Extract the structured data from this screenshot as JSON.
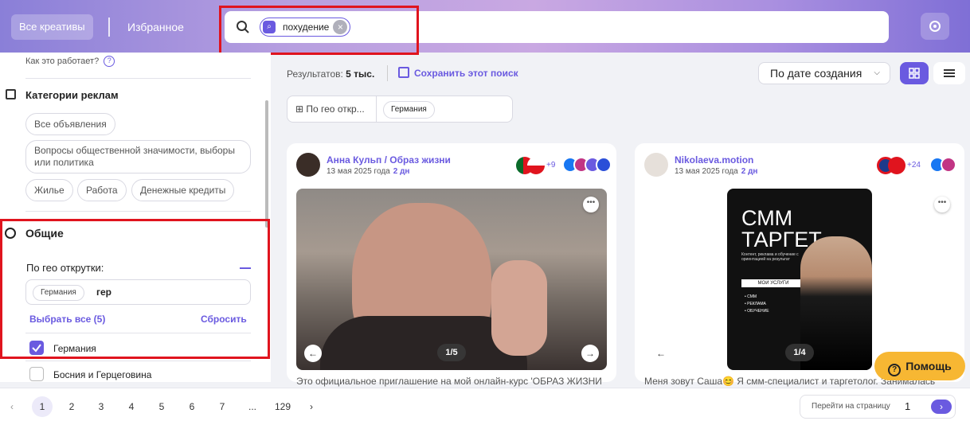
{
  "header": {
    "tab_all": "Все креативы",
    "tab_favorites": "Избранное",
    "search_chip": "похудение",
    "accent": "#6a5ae0"
  },
  "sidebar": {
    "how_it_works": "Как это работает?",
    "categories_title": "Категории реклам",
    "tags": [
      "Все объявления",
      "Вопросы общественной значимости, выборы или политика",
      "Жилье",
      "Работа",
      "Денежные кредиты"
    ],
    "general_title": "Общие",
    "geo_label": "По гео открутки:",
    "geo_chip": "Германия",
    "geo_query": "гер",
    "select_all": "Выбрать все (5)",
    "reset": "Сбросить",
    "options": [
      {
        "label": "Германия",
        "checked": true
      },
      {
        "label": "Босния и Герцеговина",
        "checked": false
      }
    ]
  },
  "toolbar": {
    "results_label": "Результатов:",
    "results_value": "5 тыс.",
    "save_search": "Сохранить этот поиск",
    "sort": "По дате создания",
    "filter_label": "По гео откр...",
    "filter_chip": "Германия"
  },
  "cards": [
    {
      "author": "Анна Кульп / Образ жизни",
      "date": "13 мая 2025 года",
      "age": "2 дн",
      "flags_more": "+9",
      "pager": "1/5",
      "description": "Это официальное приглашение на мой онлайн-курс 'ОБРАЗ ЖИЗНИ"
    },
    {
      "author": "Nikolaeva.motion",
      "date": "13 мая 2025 года",
      "age": "2 дн",
      "flags_more": "+24",
      "pager": "1/4",
      "description": "Меня зовут Саша😊 Я смм-специалист и таргетолог. Занималась",
      "poster_title_1": "СММ",
      "poster_title_2": "ТАРГЕТ",
      "poster_sub": "Контент, реклама и обучение с ориентацией на результат",
      "poster_services": "МОИ УСЛУГИ",
      "poster_list": [
        "• СММ",
        "• РЕКЛАМА",
        "• ОБУЧЕНИЕ"
      ]
    }
  ],
  "help": "Помощь",
  "pagination": {
    "pages": [
      "1",
      "2",
      "3",
      "4",
      "5",
      "6",
      "7",
      "...",
      "129"
    ],
    "goto_label": "Перейти на страницу",
    "goto_value": "1"
  }
}
